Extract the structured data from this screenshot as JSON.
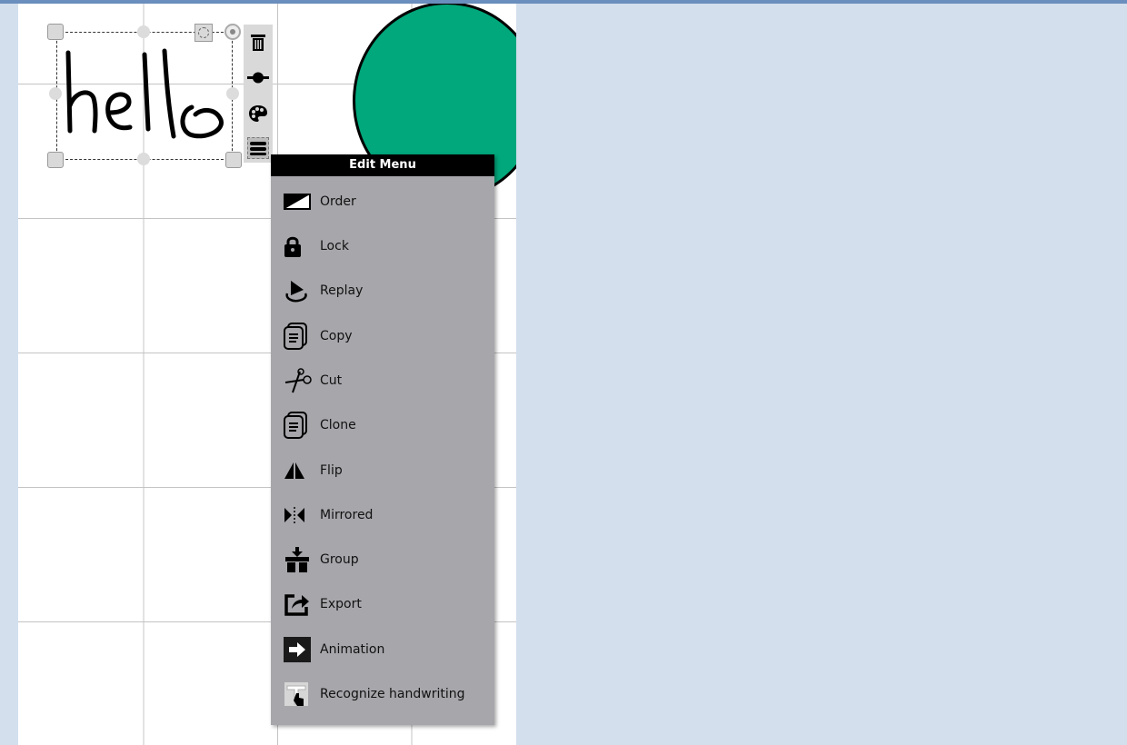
{
  "edit_menu": {
    "title": "Edit Menu",
    "items": [
      {
        "label": "Order",
        "icon": "order-icon"
      },
      {
        "label": "Lock",
        "icon": "lock-icon"
      },
      {
        "label": "Replay",
        "icon": "replay-icon"
      },
      {
        "label": "Copy",
        "icon": "copy-icon"
      },
      {
        "label": "Cut",
        "icon": "scissors-icon"
      },
      {
        "label": "Clone",
        "icon": "clone-icon"
      },
      {
        "label": "Flip",
        "icon": "flip-icon"
      },
      {
        "label": "Mirrored",
        "icon": "mirror-icon"
      },
      {
        "label": "Group",
        "icon": "group-icon"
      },
      {
        "label": "Export",
        "icon": "export-icon"
      },
      {
        "label": "Animation",
        "icon": "animation-icon"
      },
      {
        "label": "Recognize handwriting",
        "icon": "handwriting-icon"
      }
    ]
  },
  "side_toolbar": [
    "trash-icon",
    "line-width-icon",
    "palette-icon",
    "menu-icon"
  ],
  "canvas": {
    "handwriting_text": "hello",
    "colors": {
      "circle_fill": "#00a87c",
      "circle_stroke": "#000000",
      "ink": "#000000",
      "menu_bg": "#a7a6ab",
      "menu_header": "#000000",
      "panel_bg": "#d3dfed"
    }
  }
}
